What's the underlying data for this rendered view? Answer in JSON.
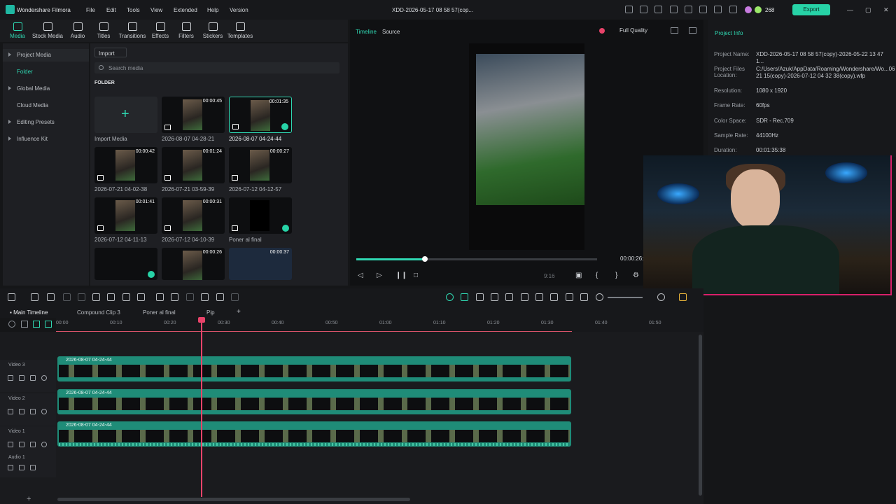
{
  "app": {
    "title": "Wondershare Filmora",
    "project_title": "XDD-2026-05-17 08 58 57(cop...",
    "credits": "268",
    "export_label": "Export"
  },
  "menu": [
    "File",
    "Edit",
    "Tools",
    "View",
    "Extended",
    "Help",
    "Version"
  ],
  "toolbar": [
    "Media",
    "Stock Media",
    "Audio",
    "Titles",
    "Transitions",
    "Effects",
    "Filters",
    "Stickers",
    "Templates"
  ],
  "sidebar": {
    "items": [
      "Project Media",
      "Folder",
      "Global Media",
      "Cloud Media",
      "Editing Presets",
      "Influence Kit"
    ]
  },
  "media": {
    "import_label": "Import",
    "search_placeholder": "Search media",
    "folder_label": "FOLDER",
    "import_media_label": "Import Media",
    "items": [
      {
        "label": "2026-08-07 04-28-21",
        "duration": "00:00:45"
      },
      {
        "label": "2026-08-07 04-24-44",
        "duration": "00:01:35"
      },
      {
        "label": "2026-07-21 04-02-38",
        "duration": "00:00:42"
      },
      {
        "label": "2026-07-21 03-59-39",
        "duration": "00:01:24"
      },
      {
        "label": "2026-07-12 04-12-57",
        "duration": "00:00:27"
      },
      {
        "label": "2026-07-12 04-11-13",
        "duration": "00:01:41"
      },
      {
        "label": "2026-07-12 04-10-39",
        "duration": "00:00:31"
      },
      {
        "label": "Poner al final",
        "duration": ""
      },
      {
        "label": "",
        "duration": ""
      },
      {
        "label": "",
        "duration": "00:00:26"
      },
      {
        "label": "",
        "duration": "00:00:37"
      }
    ]
  },
  "player": {
    "tab_timeline": "Timeline",
    "tab_source": "Source",
    "quality": "Full Quality",
    "time": "00:00:26:5",
    "aspect": "9:16",
    "progress_fraction": 0.28
  },
  "info": {
    "title": "Project Info",
    "rows": [
      {
        "k": "Project Name:",
        "v": "XDD-2026-05-17 08 58 57(copy)-2026-05-22 13 47 1..."
      },
      {
        "k": "Project Files Location:",
        "v": "C:/Users/Azuk/AppData/Roaming/Wondershare/Wo...06 21 15(copy)-2026-07-12 04 32 38(copy).wfp"
      },
      {
        "k": "Resolution:",
        "v": "1080 x 1920"
      },
      {
        "k": "Frame Rate:",
        "v": "60fps"
      },
      {
        "k": "Color Space:",
        "v": "SDR - Rec.709"
      },
      {
        "k": "Sample Rate:",
        "v": "44100Hz"
      },
      {
        "k": "Duration:",
        "v": "00:01:35:38"
      }
    ]
  },
  "timeline": {
    "tabs": [
      "Main Timeline",
      "Compound Clip 3",
      "Poner al final",
      "Pip"
    ],
    "ruler": [
      "00:00",
      "00:10",
      "00:20",
      "00:30",
      "00:40",
      "00:50",
      "01:00",
      "01:10",
      "01:20",
      "01:30",
      "01:40",
      "01:50"
    ],
    "tracks": [
      {
        "name": "Video 3",
        "clip": "2026-08-07 04-24-44"
      },
      {
        "name": "Video 2",
        "clip": "2026-08-07 04-24-44"
      },
      {
        "name": "Video 1",
        "clip": "2026-08-07 04-24-44"
      },
      {
        "name": "Audio 1",
        "clip": ""
      }
    ]
  },
  "colors": {
    "accent": "#27d3a7",
    "playhead": "#e8436a",
    "clip": "#1f8c78"
  }
}
